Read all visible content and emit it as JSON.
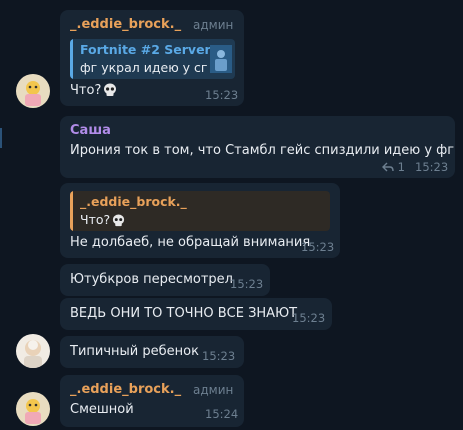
{
  "colors": {
    "background": "#0e1621",
    "bubble": "#182533",
    "orange_name": "#e8a15a",
    "purple_name": "#b18ce8",
    "blue_link": "#5aa9e6",
    "meta": "#6d7f90",
    "text": "#e9edf2"
  },
  "messages": [
    {
      "author": "_.eddie_brock._",
      "role": "админ",
      "reply": {
        "author": "Fortnite #2 Server",
        "text": "фг украл идею у сг"
      },
      "text": "Что?",
      "emoji": "skull-icon",
      "time": "15:23"
    },
    {
      "author": "Саша",
      "text": "Ирония ток в том, что Стамбл гейс спиздили идею у фг",
      "replies_count": "1",
      "time": "15:23"
    },
    {
      "reply": {
        "author": "_.eddie_brock._",
        "text": "Что?",
        "emoji": "skull-icon"
      },
      "text": "Не долбаеб, не обращай внимания",
      "time": "15:23"
    },
    {
      "text": "Ютубкров пересмотрел",
      "time": "15:23"
    },
    {
      "text": "ВЕДЬ ОНИ ТО ТОЧНО ВСЕ ЗНАЮТ",
      "time": "15:23"
    },
    {
      "text": "Типичный ребенок",
      "time": "15:23"
    },
    {
      "author": "_.eddie_brock._",
      "role": "админ",
      "text": "Смешной",
      "time": "15:24"
    }
  ]
}
